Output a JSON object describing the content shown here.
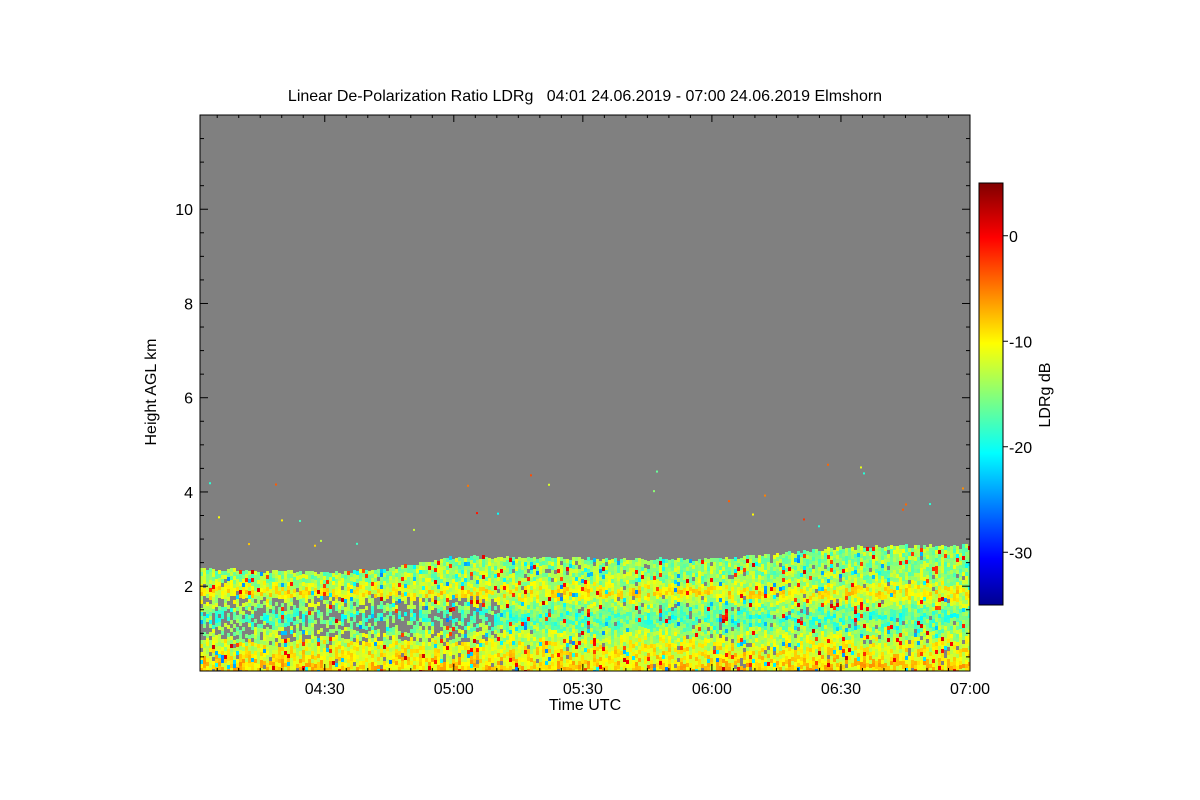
{
  "chart_data": {
    "type": "heatmap",
    "title": "Linear De-Polarization Ratio LDRg   04:01 24.06.2019 - 07:00 24.06.2019 Elmshorn",
    "xlabel": "Time UTC",
    "ylabel": "Height AGL km",
    "colorbar_label": "LDRg dB",
    "x_range": [
      "04:01",
      "07:00"
    ],
    "x_ticks": [
      "04:30",
      "05:00",
      "05:30",
      "06:00",
      "06:30",
      "07:00"
    ],
    "y_range": [
      0.2,
      12.0
    ],
    "y_ticks": [
      2,
      4,
      6,
      8,
      10
    ],
    "colorbar_range": [
      -35,
      5
    ],
    "colorbar_ticks": [
      0,
      -10,
      -20,
      -30
    ],
    "colormap": "jet",
    "no_data_color": "#808080",
    "layer_top_km": [
      {
        "time": "04:01",
        "top": 2.45
      },
      {
        "time": "04:30",
        "top": 2.35
      },
      {
        "time": "04:45",
        "top": 2.45
      },
      {
        "time": "05:00",
        "top": 2.7
      },
      {
        "time": "05:30",
        "top": 2.65
      },
      {
        "time": "06:00",
        "top": 2.65
      },
      {
        "time": "06:15",
        "top": 2.75
      },
      {
        "time": "06:30",
        "top": 2.9
      },
      {
        "time": "07:00",
        "top": 2.95
      }
    ],
    "typical_values_db": [
      {
        "height_km": 2.2,
        "ldr": -14
      },
      {
        "height_km": 1.9,
        "ldr": -10
      },
      {
        "height_km": 1.4,
        "ldr": -17
      },
      {
        "height_km": 0.9,
        "ldr": -12
      },
      {
        "height_km": 0.4,
        "ldr": -9
      }
    ]
  }
}
